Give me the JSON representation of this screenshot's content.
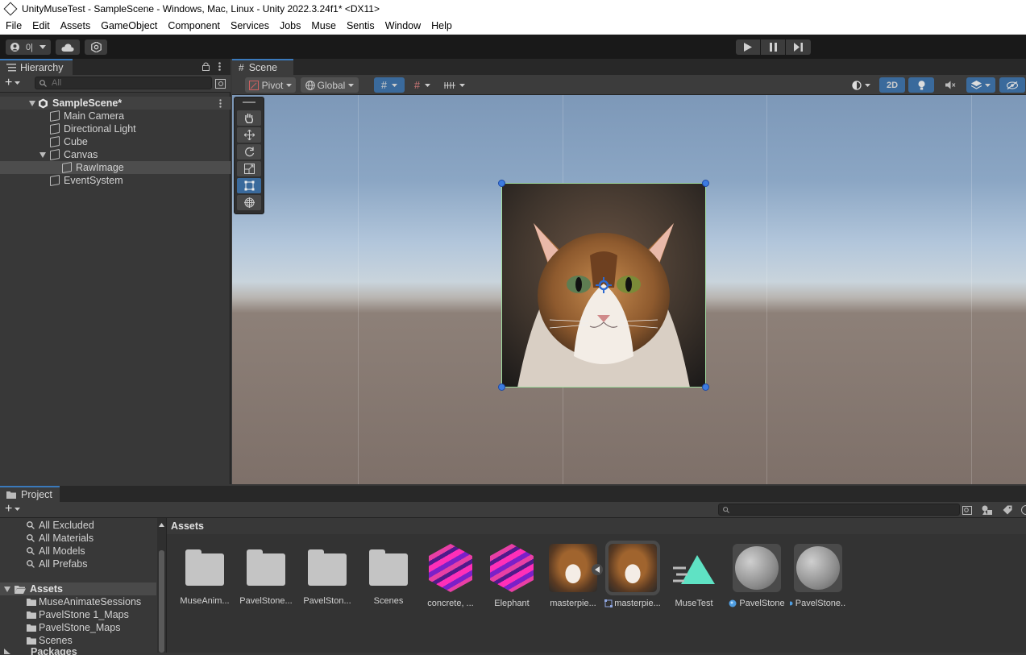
{
  "window": {
    "title": "UnityMuseTest - SampleScene - Windows, Mac, Linux - Unity 2022.3.24f1* <DX11>"
  },
  "menu": [
    "File",
    "Edit",
    "Assets",
    "GameObject",
    "Component",
    "Services",
    "Jobs",
    "Muse",
    "Sentis",
    "Window",
    "Help"
  ],
  "toolbar": {
    "account_label": "0|"
  },
  "hierarchy": {
    "tab": "Hierarchy",
    "search_placeholder": "All",
    "scene": "SampleScene*",
    "items": [
      "Main Camera",
      "Directional Light",
      "Cube",
      "Canvas",
      "RawImage",
      "EventSystem"
    ]
  },
  "scene": {
    "tab": "Scene",
    "pivot": "Pivot",
    "global": "Global",
    "mode_2d": "2D"
  },
  "project": {
    "tab": "Project",
    "favorites": [
      "All Excluded",
      "All Materials",
      "All Models",
      "All Prefabs"
    ],
    "root": "Assets",
    "folders": [
      "MuseAnimateSessions",
      "PavelStone 1_Maps",
      "PavelStone_Maps",
      "Scenes"
    ],
    "packages": "Packages",
    "breadcrumb": "Assets",
    "assets": [
      "MuseAnim...",
      "PavelStone...",
      "PavelSton...",
      "Scenes",
      "concrete, ...",
      "Elephant",
      "masterpie...",
      "masterpie...",
      "MuseTest",
      "PavelStone",
      "PavelStone..."
    ]
  },
  "colors": {
    "accent": "#3a79bb",
    "muse_teal": "#5fe2c4",
    "panel": "#383838",
    "header": "#282828"
  }
}
